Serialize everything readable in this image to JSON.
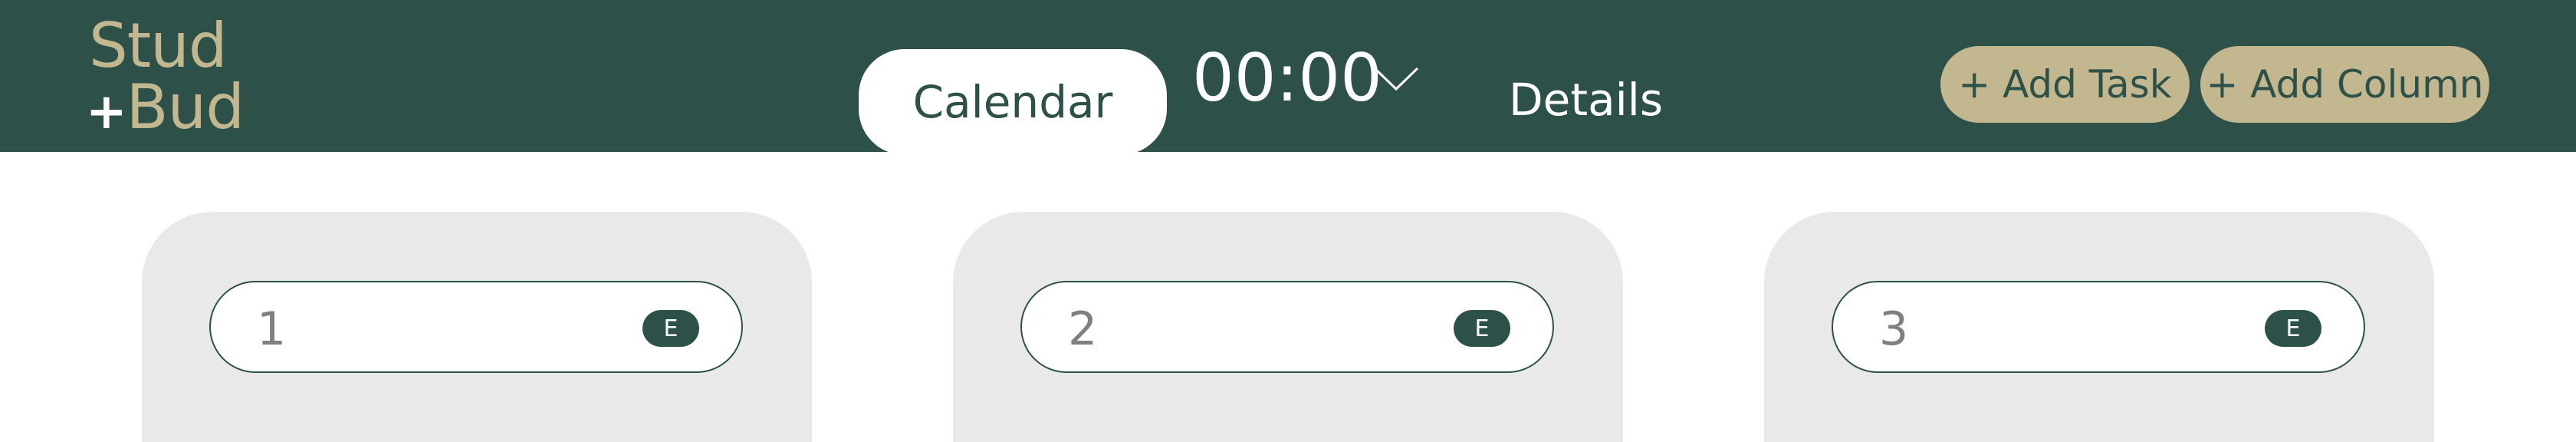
{
  "header": {
    "logo_line1": "Stud",
    "logo_plus": "+",
    "logo_line2": "Bud",
    "calendar_tab": "Calendar",
    "timer": "00:00",
    "details_tab": "Details",
    "add_task_label": "+ Add Task",
    "add_column_label": "+ Add Column"
  },
  "columns": [
    {
      "task": {
        "name": "1",
        "edit_label": "E"
      }
    },
    {
      "task": {
        "name": "2",
        "edit_label": "E"
      }
    },
    {
      "task": {
        "name": "3",
        "edit_label": "E"
      }
    }
  ],
  "colors": {
    "header_bg": "#2d5149",
    "accent": "#c2b78e",
    "column_bg": "#e9e9e9"
  },
  "icons": {
    "timer_dropdown": "chevron-down-icon"
  }
}
